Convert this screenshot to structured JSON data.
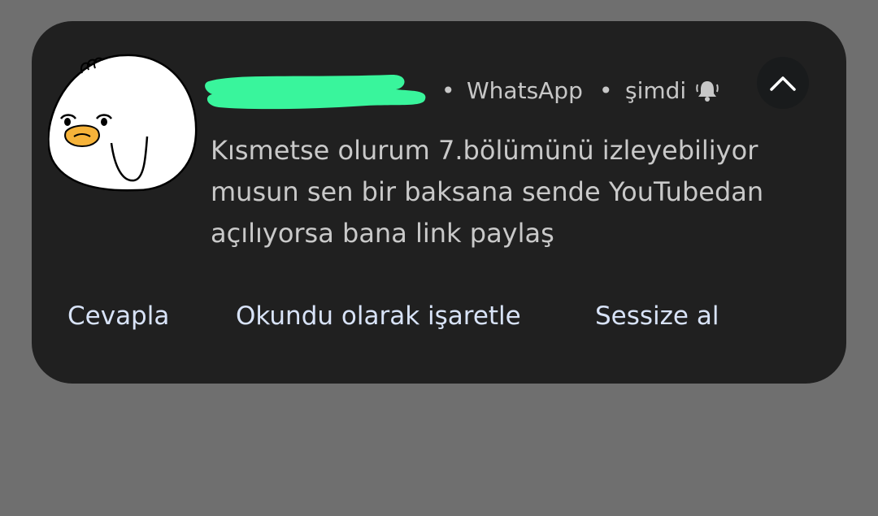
{
  "notification": {
    "sender_redacted": "",
    "app_name": "WhatsApp",
    "separator": "•",
    "time": "şimdi",
    "bell_icon": "bell-ringing-icon",
    "expand_icon": "chevron-up-icon",
    "message": "Kısmetse olurum 7.bölümünü izleyebiliyor musun sen bir baksana sende YouTubedan açılıyorsa bana link paylaş",
    "colors": {
      "card_background": "#202020",
      "page_background": "#6f6f6f",
      "action_text": "#d8e3f8",
      "redaction": "#39f59c"
    }
  },
  "actions": {
    "reply": "Cevapla",
    "mark_read": "Okundu olarak işaretle",
    "mute": "Sessize al"
  }
}
